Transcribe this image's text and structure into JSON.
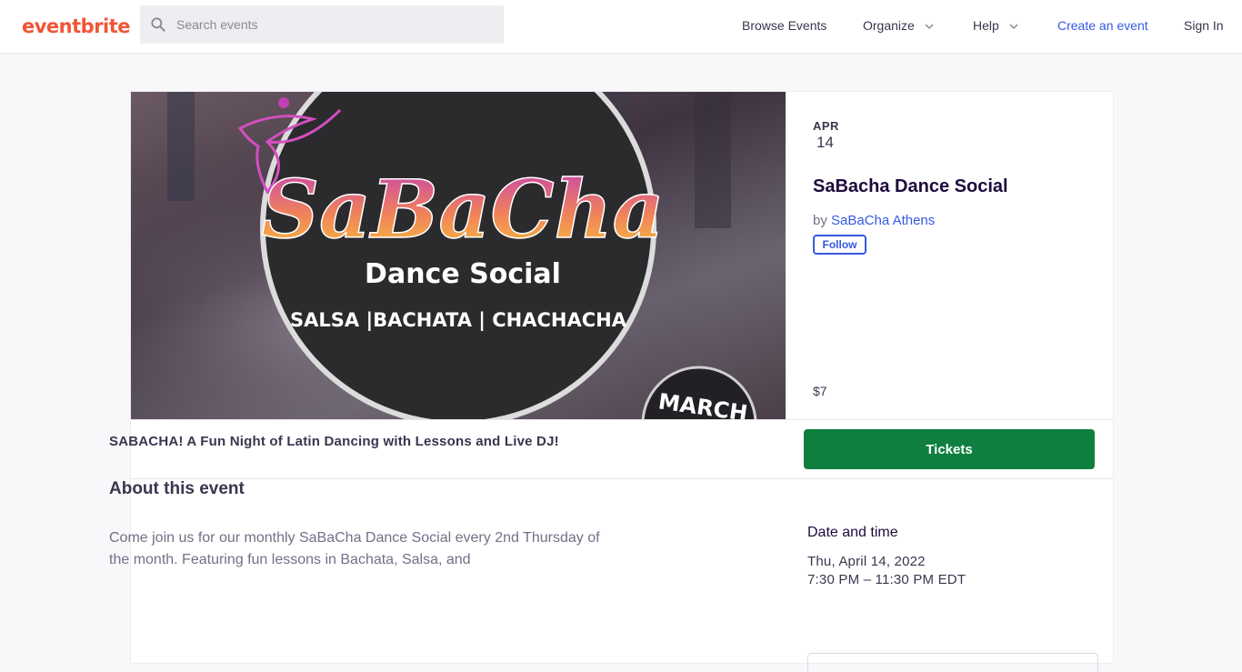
{
  "header": {
    "logo": "eventbrite",
    "search_placeholder": "Search events",
    "nav": {
      "browse": "Browse Events",
      "organize": "Organize",
      "help": "Help",
      "create": "Create an event",
      "signin": "Sign In"
    }
  },
  "hero": {
    "brand": "SaBaCha",
    "subtitle": "Dance Social",
    "styles": "SALSA |BACHATA | CHACHACHA",
    "badge": "MARCH"
  },
  "event": {
    "month": "APR",
    "day": "14",
    "title": "SaBacha Dance Social",
    "by_prefix": "by",
    "organizer": "SaBaCha Athens",
    "follow_label": "Follow",
    "price": "$7",
    "tickets_label": "Tickets"
  },
  "details": {
    "summary": "SABACHA! A Fun Night of Latin Dancing with Lessons and Live DJ!",
    "about_heading": "About this event",
    "about_text": "Come join us for our monthly SaBaCha Dance Social every 2nd Thursday of the month. Featuring fun lessons in Bachata, Salsa, and",
    "date_time_heading": "Date and time",
    "date": "Thu, April 14, 2022",
    "time": "7:30 PM – 11:30 PM EDT"
  },
  "colors": {
    "brand": "#f05537",
    "link": "#3659e3",
    "tickets": "#0e7f3f"
  }
}
